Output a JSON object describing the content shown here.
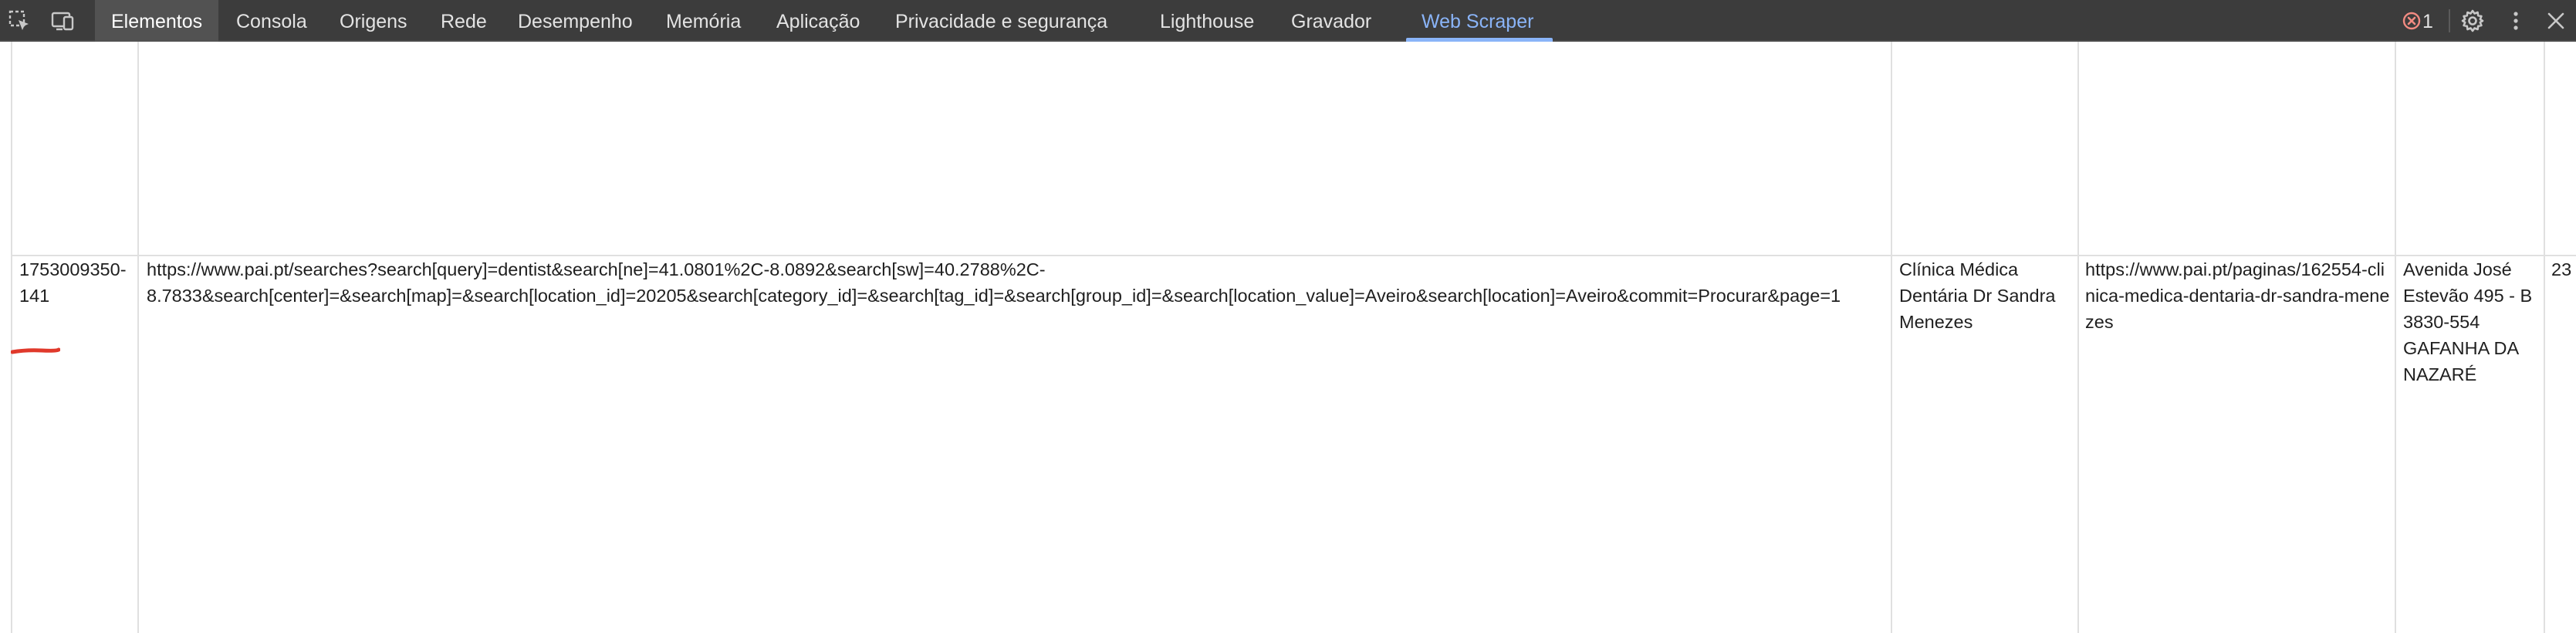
{
  "toolbar": {
    "tabs": [
      {
        "label": "Elementos"
      },
      {
        "label": "Consola"
      },
      {
        "label": "Origens"
      },
      {
        "label": "Rede"
      },
      {
        "label": "Desempenho"
      },
      {
        "label": "Memória"
      },
      {
        "label": "Aplicação"
      },
      {
        "label": "Privacidade e segurança"
      },
      {
        "label": "Lighthouse"
      },
      {
        "label": "Gravador"
      },
      {
        "label": "Web Scraper"
      }
    ],
    "active_tab": "Elementos",
    "selected_tab": "Web Scraper",
    "error_count": "1",
    "icons": [
      "inspect-element-icon",
      "device-toolbar-icon",
      "error-icon",
      "settings-gear-icon",
      "more-options-icon",
      "close-icon"
    ],
    "accent_color": "#8ab4f8",
    "error_color": "#f28b82"
  },
  "table": {
    "row": {
      "id": "1753009350-141",
      "url_line1": "https://www.pai.pt/searches?search[query]=dentist&search[ne]=41.0801%2C-8.0892&search[sw]=40.2788%2C-",
      "url_line2": "8.7833&search[center]=&search[map]=&search[location_id]=20205&search[category_id]=&search[tag_id]=&search[group_id]=&search[location_value]=Aveiro&search[location]=Aveiro&commit=Procurar&page=1",
      "name": "Clínica Médica Dentária Dr Sandra Menezes",
      "link": "https://www.pai.pt/paginas/162554-clinica-medica-dentaria-dr-sandra-menezes",
      "address": "Avenida José Estevão 495 - B 3830-554 GAFANHA DA NAZARÉ",
      "phone_partial": "23"
    },
    "annotation_color": "#e0392b"
  }
}
